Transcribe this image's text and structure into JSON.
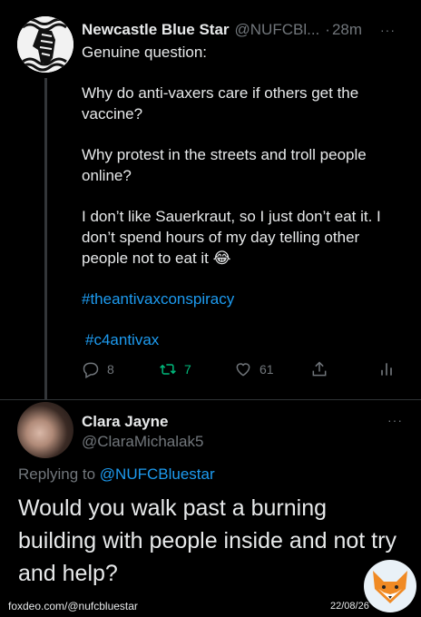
{
  "tweet": {
    "avatar_icon": "zebra-logo-icon",
    "author_name": "Newcastle Blue Star",
    "handle": "@NUFCBl...",
    "dot": "·",
    "time": "28m",
    "more": "···",
    "paragraphs": [
      "Genuine question:",
      "Why do anti-vaxers care if others get the vaccine?",
      "Why protest in the streets and troll people online?",
      "I don’t like Sauerkraut, so I just don’t eat it. I don’t spend hours of my day telling other people not to eat it 😂"
    ],
    "hashtags": [
      "#theantivaxconspiracy",
      "#c4antivax"
    ],
    "actions": {
      "reply_count": "8",
      "retweet_count": "7",
      "like_count": "61"
    },
    "colors": {
      "accent": "#1d9bf0",
      "retweet": "#00ba7c",
      "muted": "#71767b"
    }
  },
  "reply": {
    "author_name": "Clara Jayne",
    "handle": "@ClaraMichalak5",
    "more": "···",
    "replying_label": "Replying to",
    "replying_to": "@NUFCBluestar",
    "text": "Would you walk past a burning building with people inside and not try and help?"
  },
  "watermark": {
    "left": "foxdeo.com/@nufcbluestar",
    "right": "22/08/26",
    "logo_icon": "fox-logo-icon"
  }
}
